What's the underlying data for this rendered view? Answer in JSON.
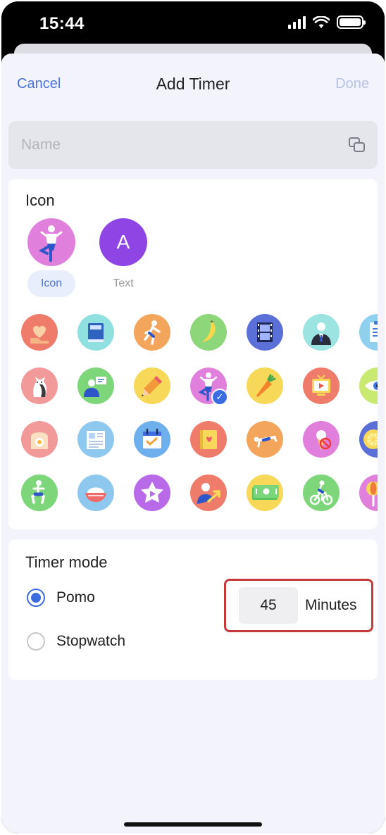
{
  "status_bar": {
    "time": "15:44"
  },
  "nav": {
    "cancel": "Cancel",
    "title": "Add Timer",
    "done": "Done"
  },
  "name_field": {
    "placeholder": "Name",
    "value": ""
  },
  "icon_section": {
    "title": "Icon",
    "type_options": [
      {
        "label": "Icon",
        "selected": true,
        "icon": "yoga-pose-icon"
      },
      {
        "label": "Text",
        "selected": false,
        "letter": "A"
      }
    ],
    "grid": [
      [
        "heart-hand-icon",
        "book-icon",
        "running-icon",
        "banana-icon",
        "film-icon",
        "businessman-icon",
        "clipboard-icon"
      ],
      [
        "cat-icon",
        "presentation-icon",
        "pencil-icon",
        "yoga-icon",
        "carrot-icon",
        "tv-icon",
        "eye-icon"
      ],
      [
        "toast-egg-icon",
        "newspaper-icon",
        "calendar-check-icon",
        "notebook-icon",
        "pushup-icon",
        "no-icecream-icon",
        "lemon-icon"
      ],
      [
        "squat-icon",
        "rice-bowl-icon",
        "star-play-icon",
        "growth-person-icon",
        "money-icon",
        "cycling-icon",
        "lollipop-icon"
      ]
    ],
    "selected_icon": "yoga-icon"
  },
  "timer_mode": {
    "title": "Timer mode",
    "options": [
      {
        "label": "Pomo",
        "selected": true
      },
      {
        "label": "Stopwatch",
        "selected": false
      }
    ],
    "minutes_value": "45",
    "minutes_unit": "Minutes"
  },
  "colors": {
    "accent": "#3b6ce0",
    "sheet_background": "#f2f3fb",
    "highlight": "#c53b3b"
  }
}
